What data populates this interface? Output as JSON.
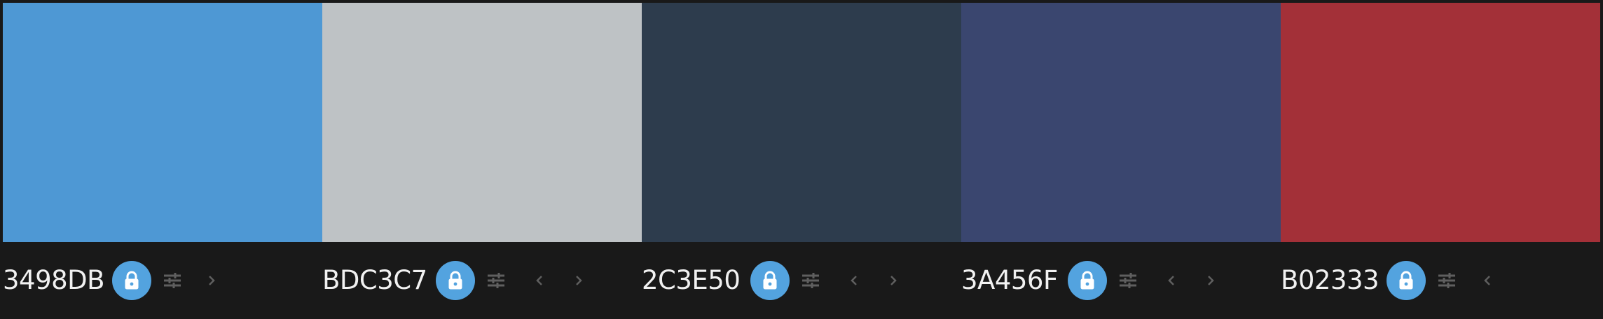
{
  "palette": {
    "colors": [
      {
        "hex": "3498DB",
        "swatch_color": "#4E98D4",
        "locked": true,
        "controls": [
          "lock-icon",
          "adjust-icon",
          "chevron-right-icon"
        ]
      },
      {
        "hex": "BDC3C7",
        "swatch_color": "#BEC2C5",
        "locked": true,
        "controls": [
          "lock-icon",
          "adjust-icon",
          "chevron-left-icon",
          "chevron-right-icon"
        ]
      },
      {
        "hex": "2C3E50",
        "swatch_color": "#2D3C4D",
        "locked": true,
        "controls": [
          "lock-icon",
          "adjust-icon",
          "chevron-left-icon",
          "chevron-right-icon"
        ]
      },
      {
        "hex": "3A456F",
        "swatch_color": "#3A466F",
        "locked": true,
        "controls": [
          "lock-icon",
          "adjust-icon",
          "chevron-left-icon",
          "chevron-right-icon"
        ]
      },
      {
        "hex": "B02333",
        "swatch_color": "#A33038",
        "locked": true,
        "controls": [
          "lock-icon",
          "adjust-icon",
          "chevron-left-icon"
        ]
      }
    ]
  },
  "theme": {
    "background": "#191919",
    "text_color": "#F1F1F1",
    "lock_button_color": "#53A3DF",
    "icon_color": "#5F5F5F"
  }
}
